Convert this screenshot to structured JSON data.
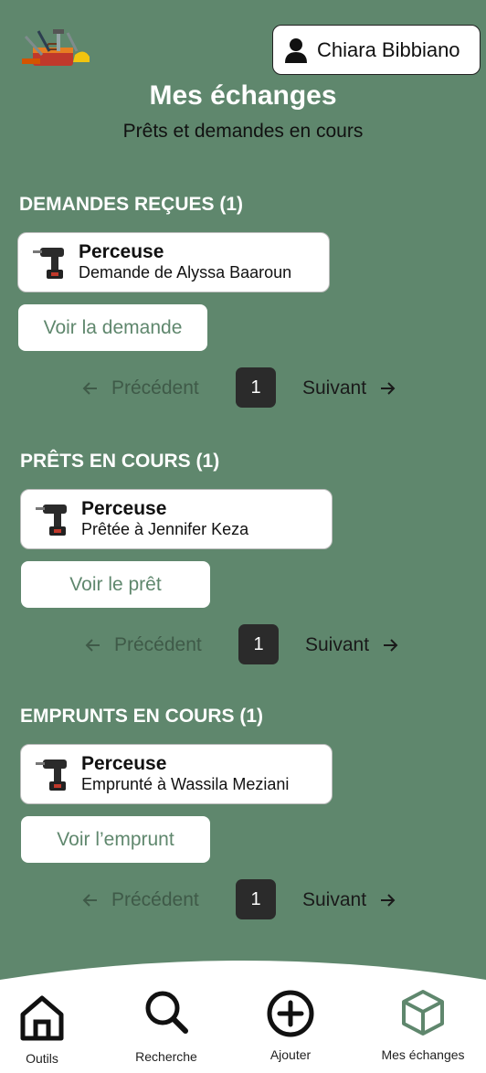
{
  "header": {
    "user_name": "Chiara Bibbiano",
    "title": "Mes échanges",
    "subtitle": "Prêts et demandes en cours"
  },
  "sections": [
    {
      "title": "DEMANDES REÇUES (1)",
      "card": {
        "name": "Perceuse",
        "desc": "Demande de Alyssa Baaroun"
      },
      "button": "Voir la demande",
      "pager": {
        "prev": "Précédent",
        "page": "1",
        "next": "Suivant"
      }
    },
    {
      "title": "PRÊTS EN COURS (1)",
      "card": {
        "name": "Perceuse",
        "desc": "Prêtée à Jennifer Keza"
      },
      "button": "Voir le prêt",
      "pager": {
        "prev": "Précédent",
        "page": "1",
        "next": "Suivant"
      }
    },
    {
      "title": "EMPRUNTS EN COURS (1)",
      "card": {
        "name": "Perceuse",
        "desc": "Emprunté à Wassila Meziani"
      },
      "button": "Voir l’emprunt",
      "pager": {
        "prev": "Précédent",
        "page": "1",
        "next": "Suivant"
      }
    }
  ],
  "nav": {
    "items": [
      "Outils",
      "Recherche",
      "Ajouter",
      "Mes échanges"
    ],
    "active": "Mes échanges"
  },
  "colors": {
    "background": "#5f876d",
    "accent": "#5f876d",
    "active_icon": "#5f876d"
  },
  "icons": {
    "logo": "toolbox-logo",
    "user": "user-icon",
    "tool": "drill-icon",
    "prev": "arrow-left-icon",
    "next": "arrow-right-icon",
    "nav": [
      "home-icon",
      "search-icon",
      "plus-circle-icon",
      "box-icon"
    ]
  }
}
